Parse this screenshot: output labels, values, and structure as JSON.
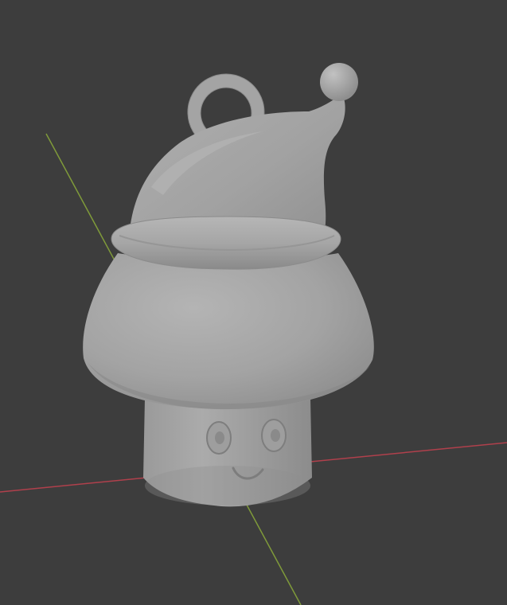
{
  "viewport": {
    "background_color": "#3d3d3d",
    "axis_x_color": "#b0404c",
    "axis_y_color": "#7f9a3a",
    "model_color": "#a8a8a8"
  },
  "model": {
    "subject": "mushroom-with-santa-hat-keychain",
    "parts": [
      "hang-loop",
      "santa-hat",
      "hat-pompom",
      "hat-brim-ring",
      "mushroom-cap",
      "mushroom-stem",
      "left-eye",
      "right-eye",
      "smile"
    ]
  }
}
